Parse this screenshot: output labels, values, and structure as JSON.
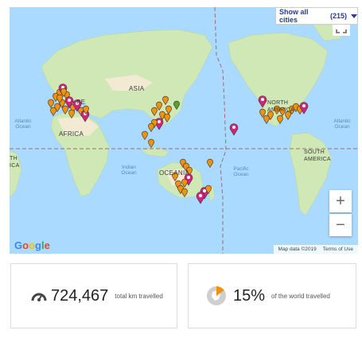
{
  "map": {
    "show_all_label": "Show all cities",
    "city_count": "(215)",
    "zoom_in": "+",
    "zoom_out": "−",
    "google_logo": [
      "G",
      "o",
      "o",
      "g",
      "l",
      "e"
    ],
    "google_logo_colors": [
      "#4285f4",
      "#ea4335",
      "#fbbc05",
      "#4285f4",
      "#34a853",
      "#ea4335"
    ],
    "attribution_data": "Map data ©2019",
    "attribution_terms": "Terms of Use",
    "labels": {
      "asia": "ASIA",
      "africa": "AFRICA",
      "oceania": "OCEANIA",
      "north_america": "NORTH AMERICA",
      "south_america": "SOUTH AMERICA",
      "europe_fragment": "PE",
      "atlantic_w": "Atlantic Ocean",
      "indian": "Indian Ocean",
      "pacific": "Pacific Ocean",
      "atlantic_e": "Atlantic Ocean",
      "south_america_left": "TH ICA"
    },
    "colors": {
      "ocean": "#aadaff",
      "land": "#cfe8b6",
      "desert": "#f2ead2",
      "pin_orange": "#f0920f",
      "pin_pink": "#d4237a",
      "pin_green": "#5aa02c",
      "dashed_line": "#9b6f73"
    }
  },
  "stats": {
    "km_value": "724,467",
    "km_label": "total km travelled",
    "world_value": "15%",
    "world_label": "of the world travelled",
    "world_fraction": 0.15
  }
}
